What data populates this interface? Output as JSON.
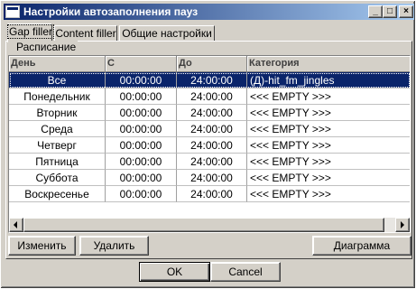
{
  "window": {
    "title": "Настройки автозаполнения пауз",
    "controls": {
      "minimize": "_",
      "maximize": "□",
      "close": "×"
    }
  },
  "tabs": [
    {
      "label": "Gap filler",
      "active": true
    },
    {
      "label": "Content filler",
      "active": false
    },
    {
      "label": "Общие настройки",
      "active": false
    }
  ],
  "schedule": {
    "group_label": "Расписание",
    "columns": [
      "День",
      "С",
      "До",
      "Категория"
    ],
    "rows": [
      {
        "day": "Все",
        "from": "00:00:00",
        "to": "24:00:00",
        "category": "(Д)-hit_fm_jingles",
        "selected": true
      },
      {
        "day": "Понедельник",
        "from": "00:00:00",
        "to": "24:00:00",
        "category": "<<< EMPTY >>>",
        "selected": false
      },
      {
        "day": "Вторник",
        "from": "00:00:00",
        "to": "24:00:00",
        "category": "<<< EMPTY >>>",
        "selected": false
      },
      {
        "day": "Среда",
        "from": "00:00:00",
        "to": "24:00:00",
        "category": "<<< EMPTY >>>",
        "selected": false
      },
      {
        "day": "Четверг",
        "from": "00:00:00",
        "to": "24:00:00",
        "category": "<<< EMPTY >>>",
        "selected": false
      },
      {
        "day": "Пятница",
        "from": "00:00:00",
        "to": "24:00:00",
        "category": "<<< EMPTY >>>",
        "selected": false
      },
      {
        "day": "Суббота",
        "from": "00:00:00",
        "to": "24:00:00",
        "category": "<<< EMPTY >>>",
        "selected": false
      },
      {
        "day": "Воскресенье",
        "from": "00:00:00",
        "to": "24:00:00",
        "category": "<<< EMPTY >>>",
        "selected": false
      }
    ]
  },
  "buttons": {
    "edit": "Изменить",
    "delete": "Удалить",
    "chart": "Диаграмма",
    "ok": "OK",
    "cancel": "Cancel"
  },
  "colors": {
    "selection": "#0a246a",
    "face": "#d4d0c8",
    "title_gradient_end": "#a6caf0"
  }
}
